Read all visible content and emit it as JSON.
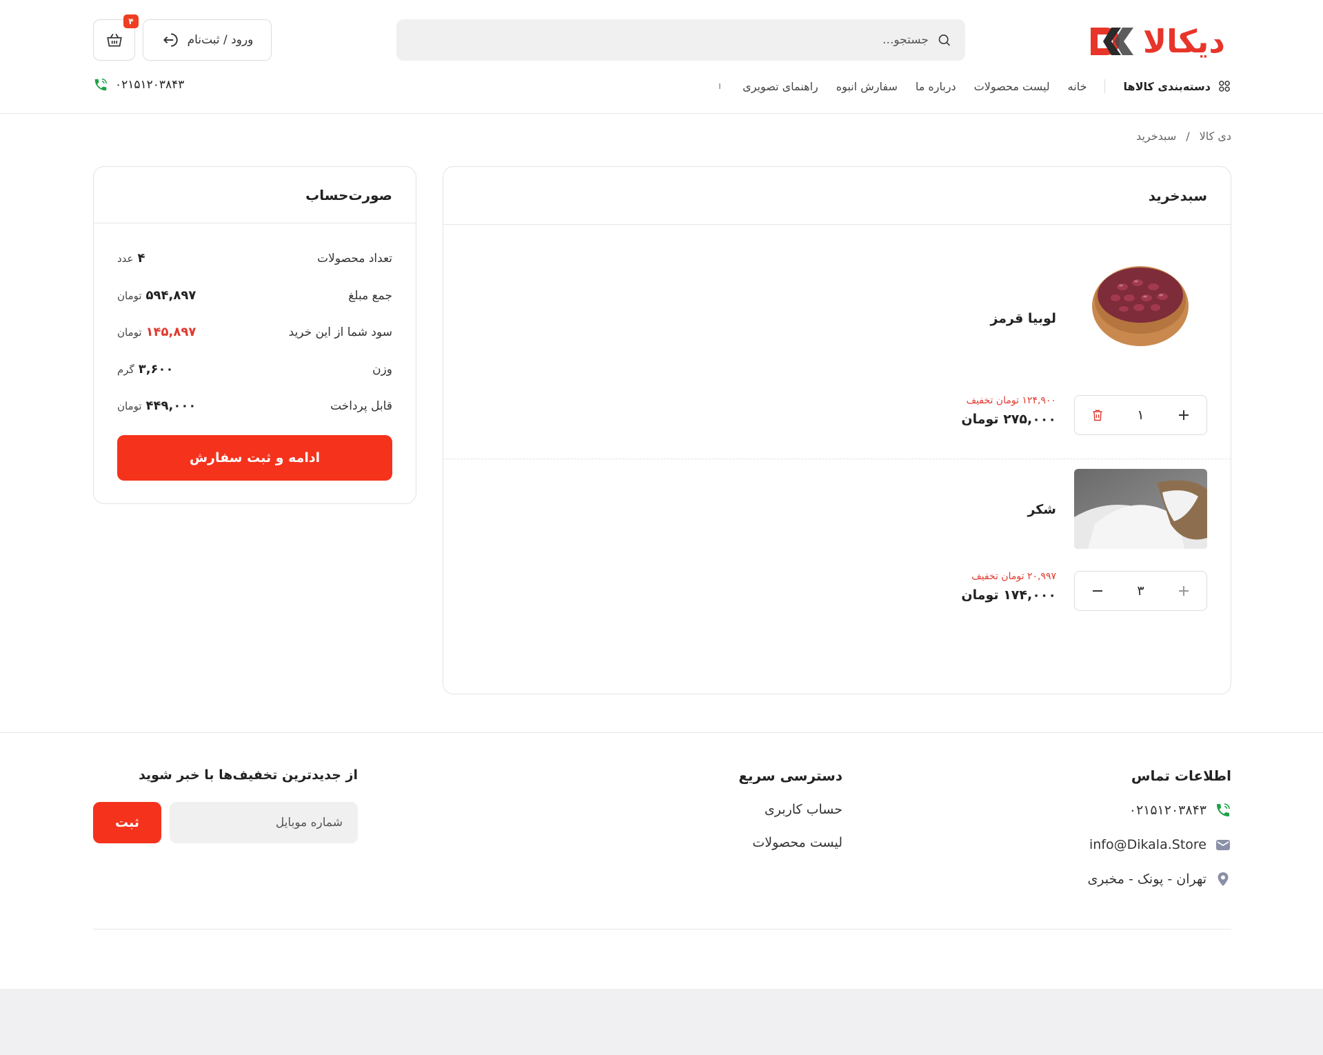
{
  "header": {
    "logo_text": "دیکالا",
    "brand_color": "#e8352a",
    "accent_color": "#f5321c",
    "search_placeholder": "جستجو...",
    "login_label": "ورود / ثبت‌نام",
    "cart_count": "۴",
    "phone": "۰۲۱۵۱۲۰۳۸۴۳"
  },
  "nav": {
    "categories_label": "دسته‌بندی کالاها",
    "items": [
      "خانه",
      "لیست محصولات",
      "درباره ما",
      "سفارش انبوه",
      "راهنمای تصویری"
    ]
  },
  "breadcrumb": {
    "home": "دی کالا",
    "separator": "/",
    "current": "سبدخرید"
  },
  "cart": {
    "title": "سبدخرید",
    "items": [
      {
        "name": "لوبیا قرمز",
        "image_icon": "red-beans-bowl",
        "quantity": "۱",
        "discount_value": "۱۲۴,۹۰۰",
        "discount_suffix": "تومان تخفیف",
        "price_value": "۲۷۵,۰۰۰",
        "price_unit": "تومان"
      },
      {
        "name": "شکر",
        "image_icon": "sugar-sack",
        "quantity": "۳",
        "discount_value": "۲۰,۹۹۷",
        "discount_suffix": "تومان تخفیف",
        "price_value": "۱۷۴,۰۰۰",
        "price_unit": "تومان"
      }
    ]
  },
  "summary": {
    "title": "صورت‌حساب",
    "rows": [
      {
        "label": "تعداد محصولات",
        "value": "۴",
        "unit": "عدد"
      },
      {
        "label": "جمع مبلغ",
        "value": "۵۹۴,۸۹۷",
        "unit": "تومان"
      },
      {
        "label": "سود شما از این خرید",
        "value": "۱۴۵,۸۹۷",
        "unit": "تومان"
      },
      {
        "label": "وزن",
        "value": "۳,۶۰۰",
        "unit": "گرم"
      },
      {
        "label": "قابل پرداخت",
        "value": "۴۴۹,۰۰۰",
        "unit": "تومان"
      }
    ],
    "checkout_label": "ادامه و ثبت سفارش"
  },
  "footer": {
    "contact_title": "اطلاعات تماس",
    "phone": "۰۲۱۵۱۲۰۳۸۴۳",
    "email": "info@Dikala.Store",
    "address": "تهران - پونک - مخبری",
    "quick_title": "دسترسی سریع",
    "quick_links": [
      "حساب کاربری",
      "لیست محصولات"
    ],
    "newsletter_title": "از جدیدترین تخفیف‌ها با خبر شوید",
    "newsletter_placeholder": "شماره موبایل",
    "newsletter_button": "ثبت"
  }
}
